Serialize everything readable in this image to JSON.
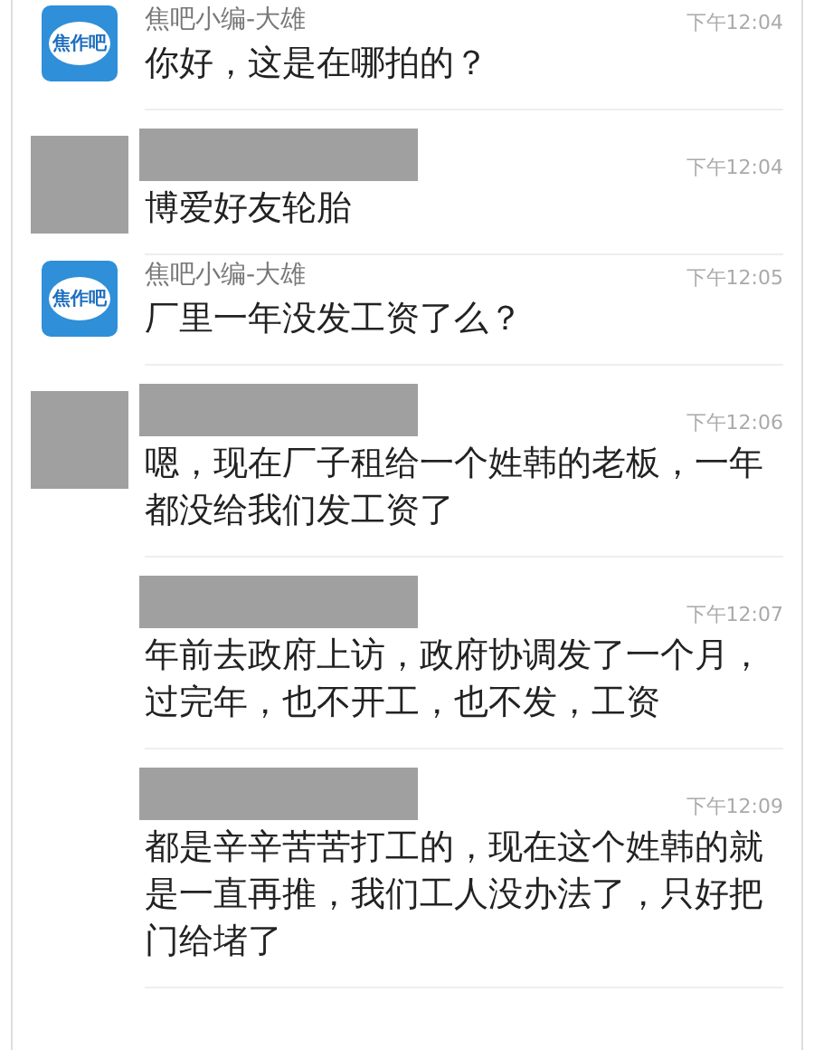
{
  "messages": [
    {
      "avatar": {
        "kind": "logo",
        "logo_text": "焦作吧"
      },
      "sender": {
        "kind": "named",
        "name": "焦吧小编-大雄"
      },
      "time": "下午12:04",
      "text": "你好，这是在哪拍的？"
    },
    {
      "avatar": {
        "kind": "redacted"
      },
      "sender": {
        "kind": "redacted"
      },
      "time": "下午12:04",
      "text": "博爱好友轮胎"
    },
    {
      "avatar": {
        "kind": "logo",
        "logo_text": "焦作吧"
      },
      "sender": {
        "kind": "named",
        "name": "焦吧小编-大雄"
      },
      "time": "下午12:05",
      "text": "厂里一年没发工资了么？"
    },
    {
      "avatar": {
        "kind": "redacted"
      },
      "sender": {
        "kind": "redacted"
      },
      "time": "下午12:06",
      "text": "嗯，现在厂子租给一个姓韩的老板，一年都没给我们发工资了"
    },
    {
      "sender": {
        "kind": "redacted"
      },
      "time": "下午12:07",
      "text": "年前去政府上访，政府协调发了一个月，过完年，也不开工，也不发，工资"
    },
    {
      "sender": {
        "kind": "redacted"
      },
      "time": "下午12:09",
      "text": "都是辛辛苦苦打工的，现在这个姓韩的就是一直再推，我们工人没办法了，只好把门给堵了"
    }
  ]
}
